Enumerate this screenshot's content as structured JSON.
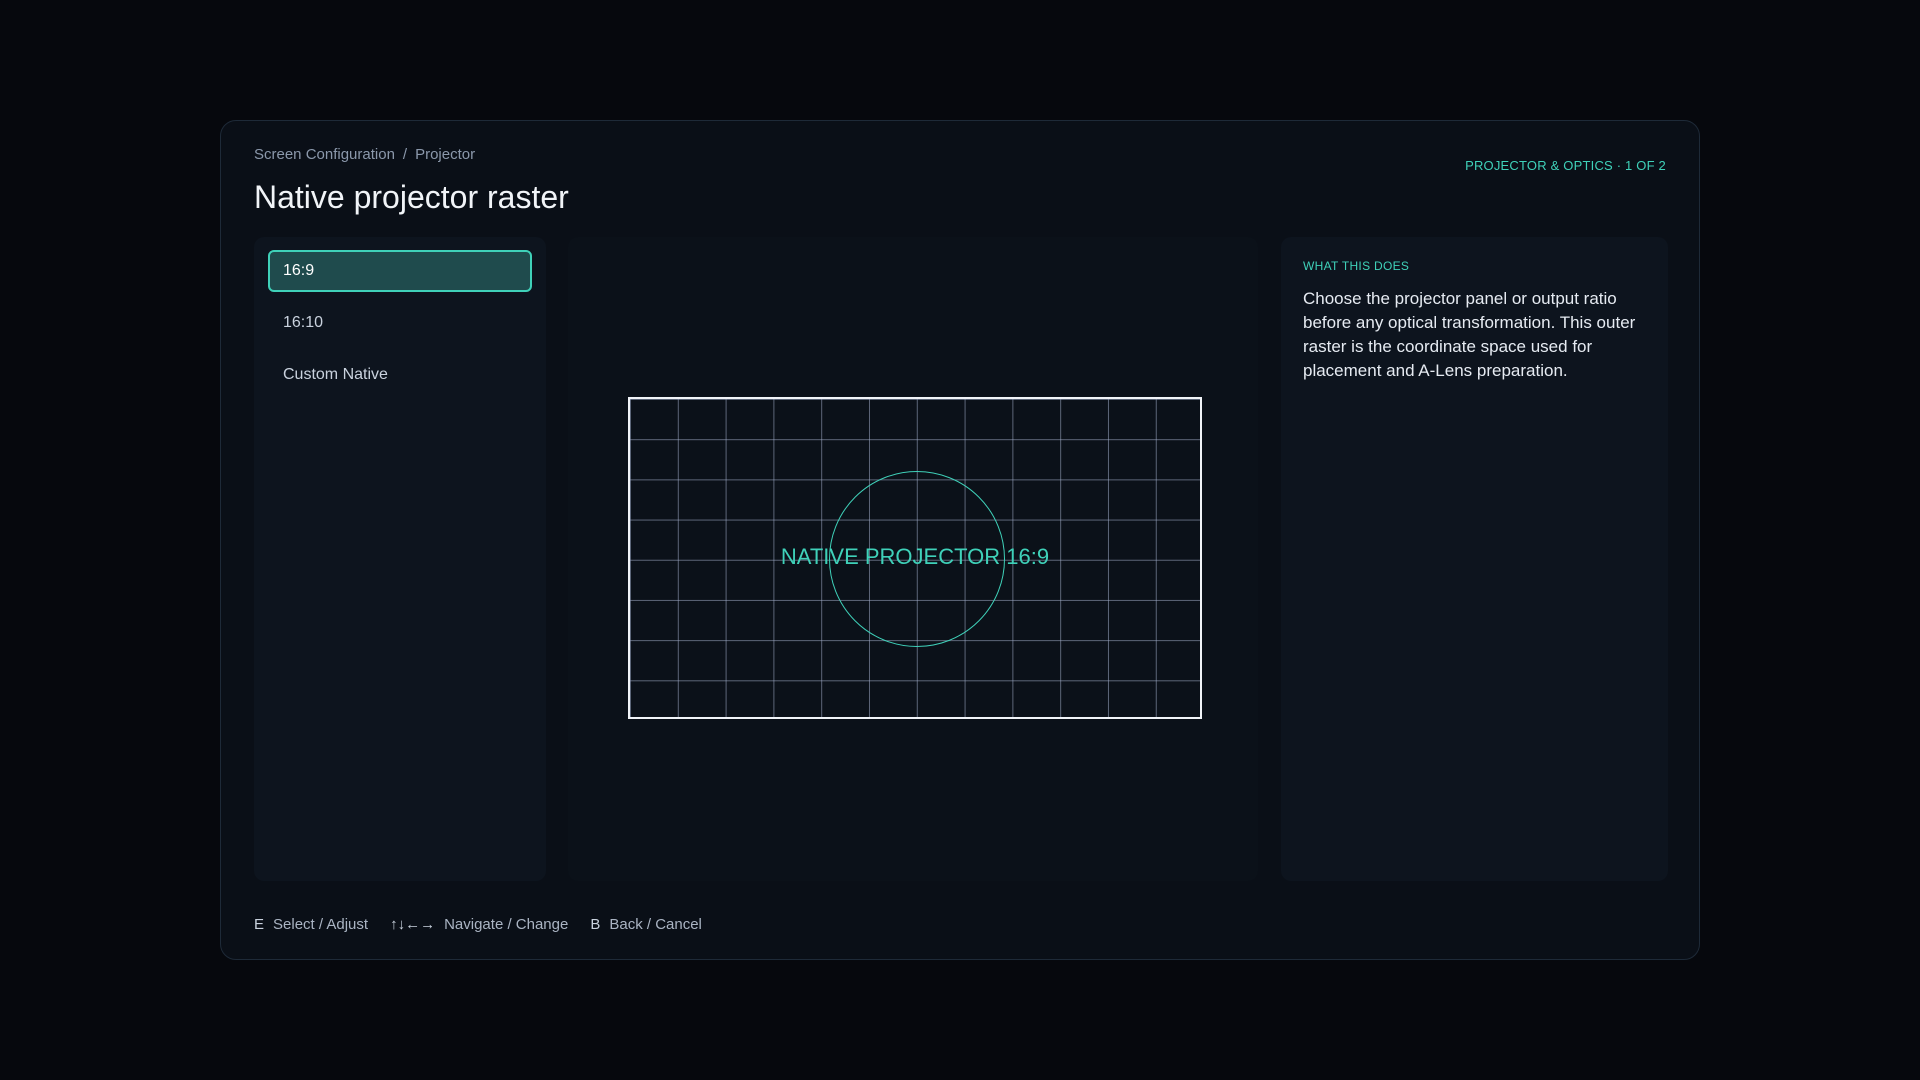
{
  "breadcrumb": {
    "items": [
      "Screen Configuration",
      "Projector"
    ],
    "separator": "/"
  },
  "page": {
    "title": "Native projector raster",
    "step_indicator": "PROJECTOR & OPTICS · 1 OF 2"
  },
  "options": [
    {
      "label": "16:9",
      "selected": true
    },
    {
      "label": "16:10",
      "selected": false
    },
    {
      "label": "Custom Native",
      "selected": false
    }
  ],
  "preview": {
    "label": "NATIVE PROJECTOR 16:9"
  },
  "info": {
    "heading": "WHAT THIS DOES",
    "body": "Choose the projector panel or output ratio before any optical transformation. This outer raster is the coordinate space used for placement and A-Lens preparation."
  },
  "footer": {
    "hints": [
      {
        "key": "E",
        "action": "Select / Adjust"
      },
      {
        "key": "↑↓←→",
        "action": "Navigate / Change"
      },
      {
        "key": "B",
        "action": "Back / Cancel"
      }
    ]
  },
  "colors": {
    "accent": "#3fd1b9",
    "selected_bg": "#1f4b4d",
    "panel_bg": "#0a0f17",
    "page_bg": "#06080d"
  }
}
